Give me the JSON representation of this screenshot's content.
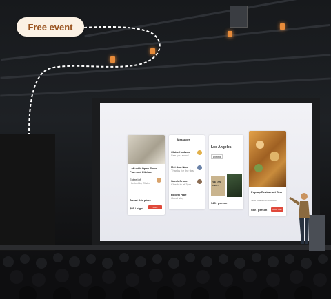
{
  "badge": {
    "label": "Free event"
  },
  "slide": {
    "card1": {
      "title": "Loft with Open Floor Plan and Kitchen",
      "host": "Entire loft",
      "host_sub": "Hosted by Claire",
      "about": "About this place",
      "price": "$95 / night",
      "button": "Book"
    },
    "card2": {
      "header": "Messages",
      "rows": [
        {
          "name": "Claire Hudson",
          "text": "See you soon!"
        },
        {
          "name": "Mei Ann Nam",
          "text": "Thanks for the tips"
        },
        {
          "name": "Sarah Crone",
          "text": "Check-in at 3pm"
        },
        {
          "name": "Robert Hale",
          "text": "Great stay"
        }
      ]
    },
    "card3": {
      "title": "Los Angeles",
      "chip": "Dining",
      "poster": "THE LIVE EVENT",
      "price": "$45 / person"
    },
    "card4": {
      "title": "Pop-up Restaurant Tour",
      "sub": "Taste local dishes downtown",
      "price": "$59 / person",
      "button": "Book now"
    }
  },
  "colors": {
    "accent": "#e0493b",
    "badge_bg": "#fbf1e4",
    "badge_text": "#9a5420"
  }
}
